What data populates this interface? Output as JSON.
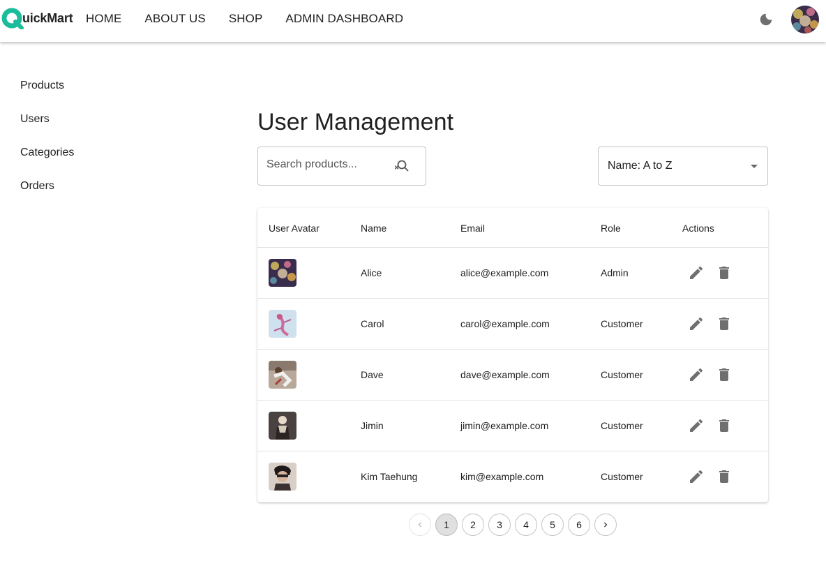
{
  "header": {
    "logo_text": "uickMart",
    "nav": [
      {
        "label": "HOME"
      },
      {
        "label": "ABOUT US"
      },
      {
        "label": "SHOP"
      },
      {
        "label": "ADMIN DASHBOARD"
      }
    ],
    "theme_toggle_icon": "moon-icon",
    "brand_color": "#1abc9c"
  },
  "sidebar": {
    "items": [
      {
        "label": "Products"
      },
      {
        "label": "Users"
      },
      {
        "label": "Categories"
      },
      {
        "label": "Orders"
      }
    ]
  },
  "main": {
    "title": "User Management",
    "search": {
      "placeholder": "Search products...",
      "value": ""
    },
    "sort": {
      "selected": "Name: A to Z"
    },
    "table": {
      "columns": [
        "User Avatar",
        "Name",
        "Email",
        "Role",
        "Actions"
      ],
      "rows": [
        {
          "name": "Alice",
          "email": "alice@example.com",
          "role": "Admin"
        },
        {
          "name": "Carol",
          "email": "carol@example.com",
          "role": "Customer"
        },
        {
          "name": "Dave",
          "email": "dave@example.com",
          "role": "Customer"
        },
        {
          "name": "Jimin",
          "email": "jimin@example.com",
          "role": "Customer"
        },
        {
          "name": "Kim Taehung",
          "email": "kim@example.com",
          "role": "Customer"
        }
      ]
    },
    "pagination": {
      "pages": [
        "1",
        "2",
        "3",
        "4",
        "5",
        "6"
      ],
      "current": "1"
    }
  }
}
